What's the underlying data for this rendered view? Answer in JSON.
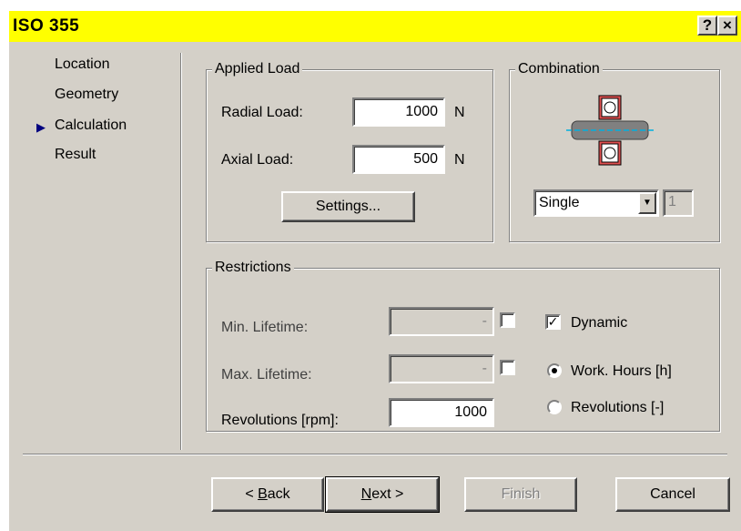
{
  "window": {
    "title": "ISO 355",
    "help_button": "?",
    "close_button": "×"
  },
  "nav": {
    "items": [
      {
        "label": "Location",
        "active": false
      },
      {
        "label": "Geometry",
        "active": false
      },
      {
        "label": "Calculation",
        "active": true
      },
      {
        "label": "Result",
        "active": false
      }
    ],
    "active_marker": "▶"
  },
  "applied_load": {
    "legend": "Applied Load",
    "radial_label": "Radial Load:",
    "radial_value": "1000",
    "radial_unit": "N",
    "axial_label": "Axial Load:",
    "axial_value": "500",
    "axial_unit": "N",
    "settings_button": "Settings..."
  },
  "combination": {
    "legend": "Combination",
    "select_value": "Single",
    "count_value": "1",
    "icon": "bearing-cross-section-icon"
  },
  "restrictions": {
    "legend": "Restrictions",
    "min_lifetime_label": "Min. Lifetime:",
    "min_lifetime_value": "-",
    "min_lifetime_checked": false,
    "max_lifetime_label": "Max. Lifetime:",
    "max_lifetime_value": "-",
    "max_lifetime_checked": false,
    "revolutions_label": "Revolutions [rpm]:",
    "revolutions_value": "1000",
    "dynamic_label": "Dynamic",
    "dynamic_checked": true,
    "work_hours_label": "Work. Hours [h]",
    "work_hours_selected": true,
    "revolutions_radio_label": "Revolutions [-]",
    "revolutions_radio_selected": false
  },
  "footer": {
    "back_prefix": "< ",
    "back_mnemonic": "B",
    "back_rest": "ack",
    "next_mnemonic": "N",
    "next_rest": "ext >",
    "finish": "Finish",
    "cancel": "Cancel"
  },
  "colors": {
    "titlebar": "#ffff00",
    "face": "#d4d0c8",
    "marker": "#00007f",
    "bearing_ring": "#e05050",
    "shaft": "#808080",
    "axis_line": "#00b0e0"
  }
}
